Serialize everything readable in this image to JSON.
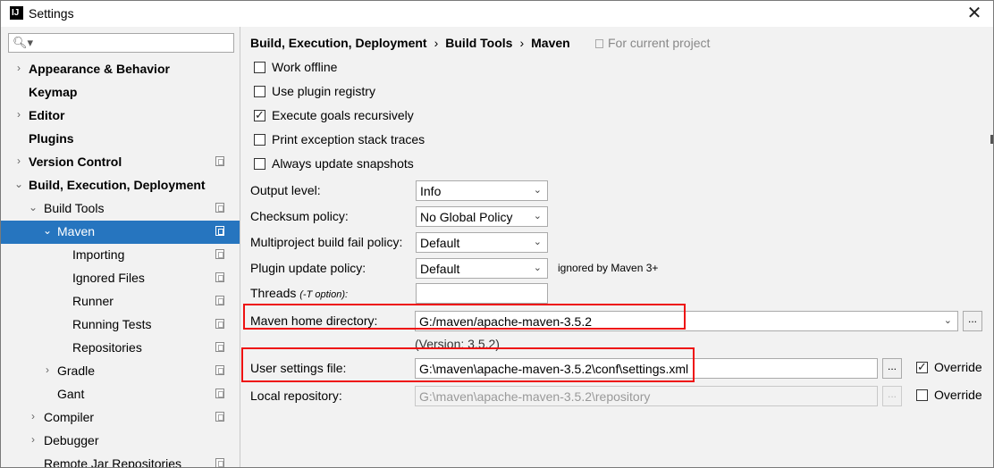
{
  "window": {
    "title": "Settings",
    "app_icon": "IJ"
  },
  "sidebar": {
    "search": {
      "value": ""
    },
    "items": [
      {
        "label": "Appearance & Behavior",
        "bold": true,
        "arrow": "›",
        "indent": 0
      },
      {
        "label": "Keymap",
        "bold": true,
        "arrow": "",
        "indent": 0
      },
      {
        "label": "Editor",
        "bold": true,
        "arrow": "›",
        "indent": 0
      },
      {
        "label": "Plugins",
        "bold": true,
        "arrow": "",
        "indent": 0
      },
      {
        "label": "Version Control",
        "bold": true,
        "arrow": "›",
        "indent": 0,
        "proj": true
      },
      {
        "label": "Build, Execution, Deployment",
        "bold": true,
        "arrow": "⌄",
        "indent": 0
      },
      {
        "label": "Build Tools",
        "bold": false,
        "arrow": "⌄",
        "indent": 1,
        "proj": true
      },
      {
        "label": "Maven",
        "bold": false,
        "arrow": "⌄",
        "indent": 2,
        "proj": true,
        "selected": true
      },
      {
        "label": "Importing",
        "bold": false,
        "arrow": "",
        "indent": 3,
        "proj": true
      },
      {
        "label": "Ignored Files",
        "bold": false,
        "arrow": "",
        "indent": 3,
        "proj": true
      },
      {
        "label": "Runner",
        "bold": false,
        "arrow": "",
        "indent": 3,
        "proj": true
      },
      {
        "label": "Running Tests",
        "bold": false,
        "arrow": "",
        "indent": 3,
        "proj": true
      },
      {
        "label": "Repositories",
        "bold": false,
        "arrow": "",
        "indent": 3,
        "proj": true
      },
      {
        "label": "Gradle",
        "bold": false,
        "arrow": "›",
        "indent": 2,
        "proj": true
      },
      {
        "label": "Gant",
        "bold": false,
        "arrow": "",
        "indent": 2,
        "proj": true
      },
      {
        "label": "Compiler",
        "bold": false,
        "arrow": "›",
        "indent": 1,
        "proj": true
      },
      {
        "label": "Debugger",
        "bold": false,
        "arrow": "›",
        "indent": 1
      },
      {
        "label": "Remote Jar Repositories",
        "bold": false,
        "arrow": "",
        "indent": 1,
        "proj": true
      }
    ]
  },
  "breadcrumb": {
    "parts": [
      "Build, Execution, Deployment",
      "Build Tools",
      "Maven"
    ],
    "separator": "›",
    "note": "For current project"
  },
  "options": [
    {
      "label": "Work offline",
      "checked": false
    },
    {
      "label": "Use plugin registry",
      "checked": false
    },
    {
      "label": "Execute goals recursively",
      "checked": true
    },
    {
      "label": "Print exception stack traces",
      "checked": false
    },
    {
      "label": "Always update snapshots",
      "checked": false
    }
  ],
  "selects": [
    {
      "label": "Output level:",
      "value": "Info"
    },
    {
      "label": "Checksum policy:",
      "value": "No Global Policy"
    },
    {
      "label": "Multiproject build fail policy:",
      "value": "Default"
    },
    {
      "label": "Plugin update policy:",
      "value": "Default",
      "note": "ignored by Maven 3+"
    }
  ],
  "threads": {
    "label": "Threads",
    "hint": "(-T option):",
    "value": ""
  },
  "maven_home": {
    "label": "Maven home directory:",
    "value": "G:/maven/apache-maven-3.5.2",
    "version": "(Version: 3.5.2)"
  },
  "user_settings": {
    "label": "User settings file:",
    "value": "G:\\maven\\apache-maven-3.5.2\\conf\\settings.xml",
    "override_label": "Override",
    "override": true
  },
  "local_repo": {
    "label": "Local repository:",
    "value": "G:\\maven\\apache-maven-3.5.2\\repository",
    "override_label": "Override",
    "override": false
  },
  "dots_label": "...",
  "colors": {
    "selection": "#2675bf",
    "highlight_box": "#e11111"
  }
}
